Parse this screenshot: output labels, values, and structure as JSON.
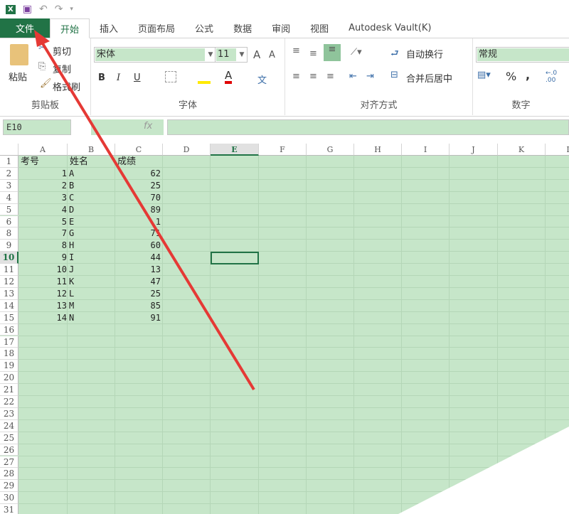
{
  "qat": {
    "undo": "↶",
    "redo": "↷"
  },
  "tabs": [
    {
      "label": "文件"
    },
    {
      "label": "开始"
    },
    {
      "label": "插入"
    },
    {
      "label": "页面布局"
    },
    {
      "label": "公式"
    },
    {
      "label": "数据"
    },
    {
      "label": "审阅"
    },
    {
      "label": "视图"
    },
    {
      "label": "Autodesk Vault(K)"
    }
  ],
  "clipboard": {
    "paste": "粘贴",
    "cut": "剪切",
    "copy": "复制",
    "format_painter": "格式刷",
    "label": "剪贴板"
  },
  "font": {
    "name": "宋体",
    "size": "11",
    "bold": "B",
    "italic": "I",
    "underline": "U",
    "label": "字体",
    "grow": "A",
    "shrink": "A",
    "font_color": "A",
    "phonetic": "文"
  },
  "align": {
    "wrap": "自动换行",
    "merge": "合并后居中",
    "label": "对齐方式"
  },
  "number": {
    "format": "常规",
    "percent": "%",
    "comma": ",",
    "label": "数字"
  },
  "formula": {
    "namebox": "E10",
    "fx": "fx",
    "value": ""
  },
  "columns": [
    "A",
    "B",
    "C",
    "D",
    "E",
    "F",
    "G",
    "H",
    "I",
    "J",
    "K",
    "L"
  ],
  "rows": [
    "1",
    "2",
    "3",
    "4",
    "5",
    "6",
    "8",
    "9",
    "10",
    "11",
    "12",
    "13",
    "14",
    "15",
    "16",
    "17",
    "18",
    "19",
    "20",
    "21",
    "22",
    "23",
    "24",
    "25",
    "26",
    "27",
    "28",
    "29",
    "30",
    "31"
  ],
  "headers": [
    "考号",
    "姓名",
    "成绩"
  ],
  "records": [
    [
      "1",
      "A",
      "62"
    ],
    [
      "2",
      "B",
      "25"
    ],
    [
      "3",
      "C",
      "70"
    ],
    [
      "4",
      "D",
      "89"
    ],
    [
      "5",
      "E",
      "1"
    ],
    [
      "7",
      "G",
      "71"
    ],
    [
      "8",
      "H",
      "60"
    ],
    [
      "9",
      "I",
      "44"
    ],
    [
      "10",
      "J",
      "13"
    ],
    [
      "11",
      "K",
      "47"
    ],
    [
      "12",
      "L",
      "25"
    ],
    [
      "13",
      "M",
      "85"
    ],
    [
      "14",
      "N",
      "91"
    ]
  ],
  "selected_cell": "E10",
  "colors": {
    "accent": "#217346",
    "sheet_bg": "#c6e6c9",
    "arrow": "#e53935"
  }
}
